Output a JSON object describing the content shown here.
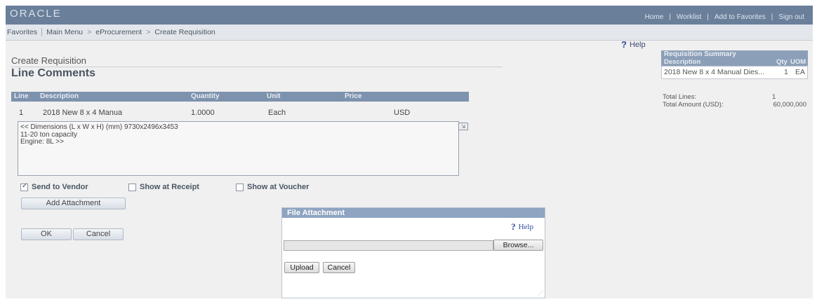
{
  "header": {
    "logo": "ORACLE",
    "links": [
      "Home",
      "Worklist",
      "Add to Favorites",
      "Sign out"
    ]
  },
  "breadcrumb": {
    "favorites": "Favorites",
    "main_menu": "Main Menu",
    "eprocurement": "eProcurement",
    "current": "Create Requisition"
  },
  "help_label": "Help",
  "page": {
    "subtitle": "Create Requisition",
    "title": "Line Comments"
  },
  "line_table": {
    "headers": {
      "line": "Line",
      "description": "Description",
      "quantity": "Quantity",
      "unit": "Unit",
      "price": "Price"
    },
    "row": {
      "line": "1",
      "description": "2018 New 8 x 4 Manua",
      "quantity": "1.0000",
      "unit": "Each",
      "currency": "USD"
    }
  },
  "comment_text": "<< Dimensions (L x W x H) (mm) 9730x2496x3453\n11-20 ton capacity\nEngine: 8L >>",
  "options": {
    "send_to_vendor": {
      "label": "Send to Vendor",
      "checked": true
    },
    "show_at_receipt": {
      "label": "Show at Receipt",
      "checked": false
    },
    "show_at_voucher": {
      "label": "Show at Voucher",
      "checked": false
    }
  },
  "buttons": {
    "add_attachment": "Add Attachment",
    "ok": "OK",
    "cancel": "Cancel"
  },
  "summary": {
    "title": "Requisition Summary",
    "col_description": "Description",
    "col_qty": "Qty",
    "col_uom": "UOM",
    "item_description": "2018 New 8 x 4 Manual Dies...",
    "item_qty": "1",
    "item_uom": "EA",
    "total_lines_label": "Total Lines:",
    "total_lines_value": "1",
    "total_amount_label": "Total Amount (USD):",
    "total_amount_value": "60,000,000"
  },
  "modal": {
    "title": "File Attachment",
    "help": "Help",
    "file_value": "",
    "browse": "Browse...",
    "upload": "Upload",
    "cancel": "Cancel"
  }
}
